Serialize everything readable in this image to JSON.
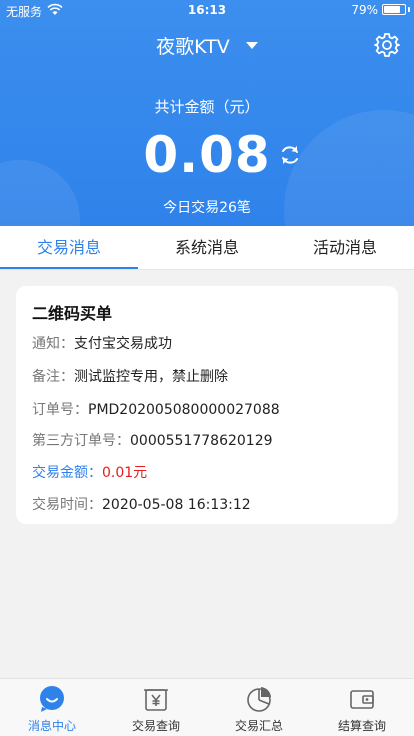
{
  "status_bar": {
    "carrier": "无服务",
    "time": "16:13",
    "battery_text": "79%",
    "battery_level": 0.79
  },
  "header": {
    "title": "夜歌KTV",
    "total_label": "共计金额（元）",
    "total_amount": "0.08",
    "today_summary": "今日交易26笔"
  },
  "tabs": [
    {
      "label": "交易消息",
      "active": true
    },
    {
      "label": "系统消息",
      "active": false
    },
    {
      "label": "活动消息",
      "active": false
    }
  ],
  "message": {
    "title": "二维码买单",
    "rows": [
      {
        "label": "通知：",
        "value": "支付宝交易成功"
      },
      {
        "label": "备注：",
        "value": "测试监控专用，禁止删除"
      },
      {
        "label": "订单号：",
        "value": "PMD202005080000027088"
      },
      {
        "label": "第三方订单号：",
        "value": "0000551778620129"
      },
      {
        "label": "交易金额：",
        "value": "0.01元"
      },
      {
        "label": "交易时间：",
        "value": "2020-05-08 16:13:12"
      }
    ]
  },
  "bottom_nav": [
    {
      "label": "消息中心",
      "icon": "message-bubble-icon",
      "active": true
    },
    {
      "label": "交易查询",
      "icon": "yuan-receipt-icon",
      "active": false
    },
    {
      "label": "交易汇总",
      "icon": "pie-chart-icon",
      "active": false
    },
    {
      "label": "结算查询",
      "icon": "wallet-icon",
      "active": false
    }
  ],
  "colors": {
    "primary": "#2f82ea",
    "amount_red": "#e02020",
    "background": "#f2f2f2"
  }
}
